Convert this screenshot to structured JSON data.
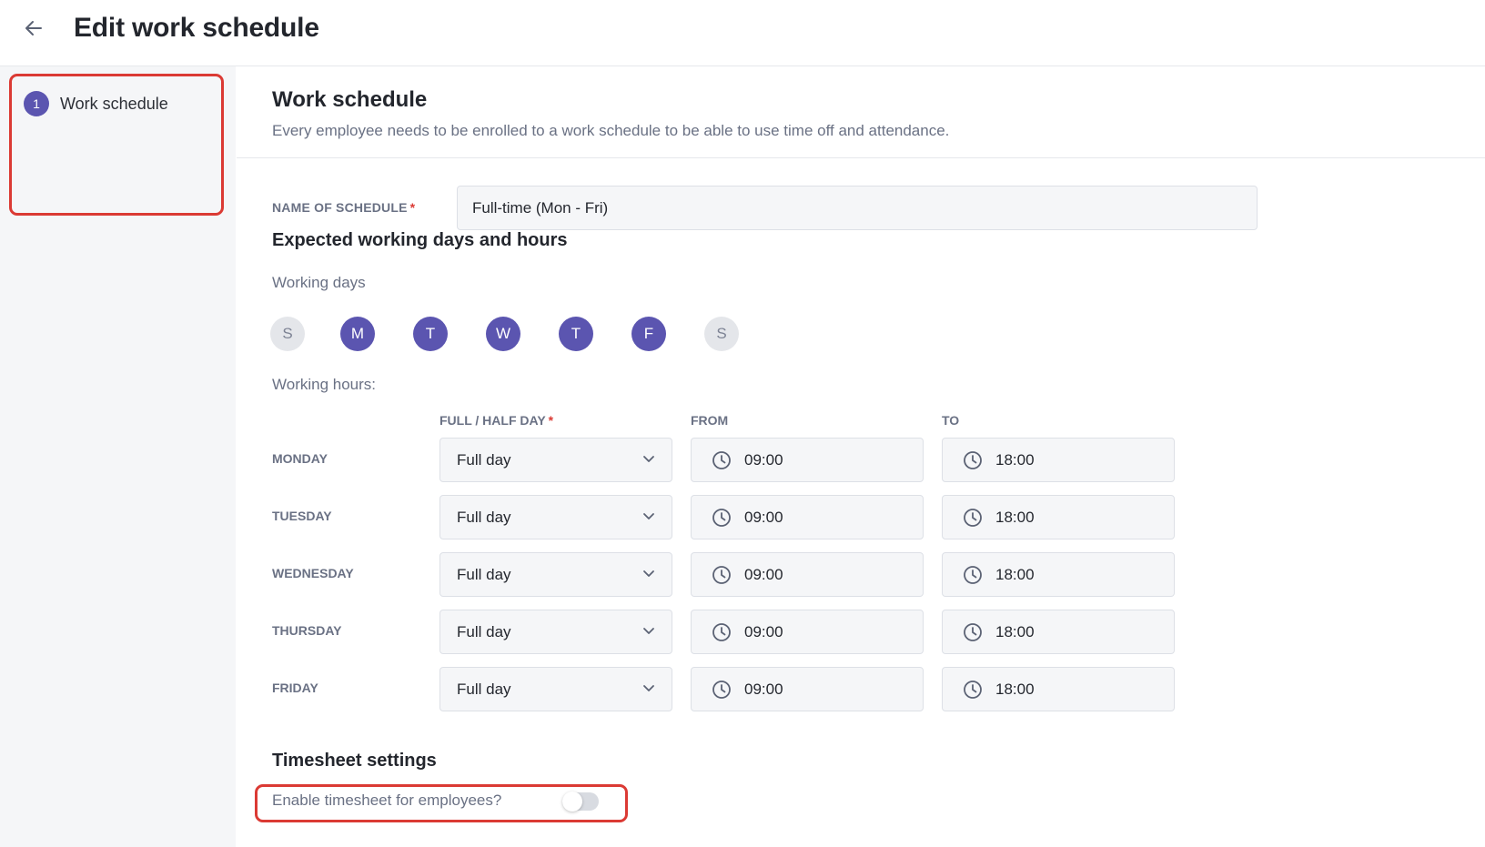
{
  "header": {
    "title": "Edit work schedule"
  },
  "sidebar": {
    "steps": [
      {
        "number": "1",
        "label": "Work schedule"
      }
    ]
  },
  "section": {
    "title": "Work schedule",
    "subtitle": "Every employee needs to be enrolled to a work schedule to be able to use time off and attendance."
  },
  "schedule_name": {
    "label": "NAME OF SCHEDULE",
    "required_mark": "*",
    "value": "Full-time (Mon - Fri)"
  },
  "expected": {
    "title": "Expected working days and hours"
  },
  "working_days": {
    "label": "Working days",
    "days": [
      {
        "letter": "S",
        "active": false
      },
      {
        "letter": "M",
        "active": true
      },
      {
        "letter": "T",
        "active": true
      },
      {
        "letter": "W",
        "active": true
      },
      {
        "letter": "T",
        "active": true
      },
      {
        "letter": "F",
        "active": true
      },
      {
        "letter": "S",
        "active": false
      }
    ]
  },
  "working_hours": {
    "label": "Working hours:",
    "columns": {
      "type": "FULL / HALF DAY",
      "required_mark": "*",
      "from": "FROM",
      "to": "TO"
    },
    "rows": [
      {
        "day": "MONDAY",
        "type": "Full day",
        "from": "09:00",
        "to": "18:00"
      },
      {
        "day": "TUESDAY",
        "type": "Full day",
        "from": "09:00",
        "to": "18:00"
      },
      {
        "day": "WEDNESDAY",
        "type": "Full day",
        "from": "09:00",
        "to": "18:00"
      },
      {
        "day": "THURSDAY",
        "type": "Full day",
        "from": "09:00",
        "to": "18:00"
      },
      {
        "day": "FRIDAY",
        "type": "Full day",
        "from": "09:00",
        "to": "18:00"
      }
    ]
  },
  "timesheet": {
    "title": "Timesheet settings",
    "toggle_label": "Enable timesheet for employees?",
    "enabled": false
  },
  "colors": {
    "accent": "#5b55b0",
    "highlight": "#db3a34",
    "muted_text": "#6a7184"
  }
}
